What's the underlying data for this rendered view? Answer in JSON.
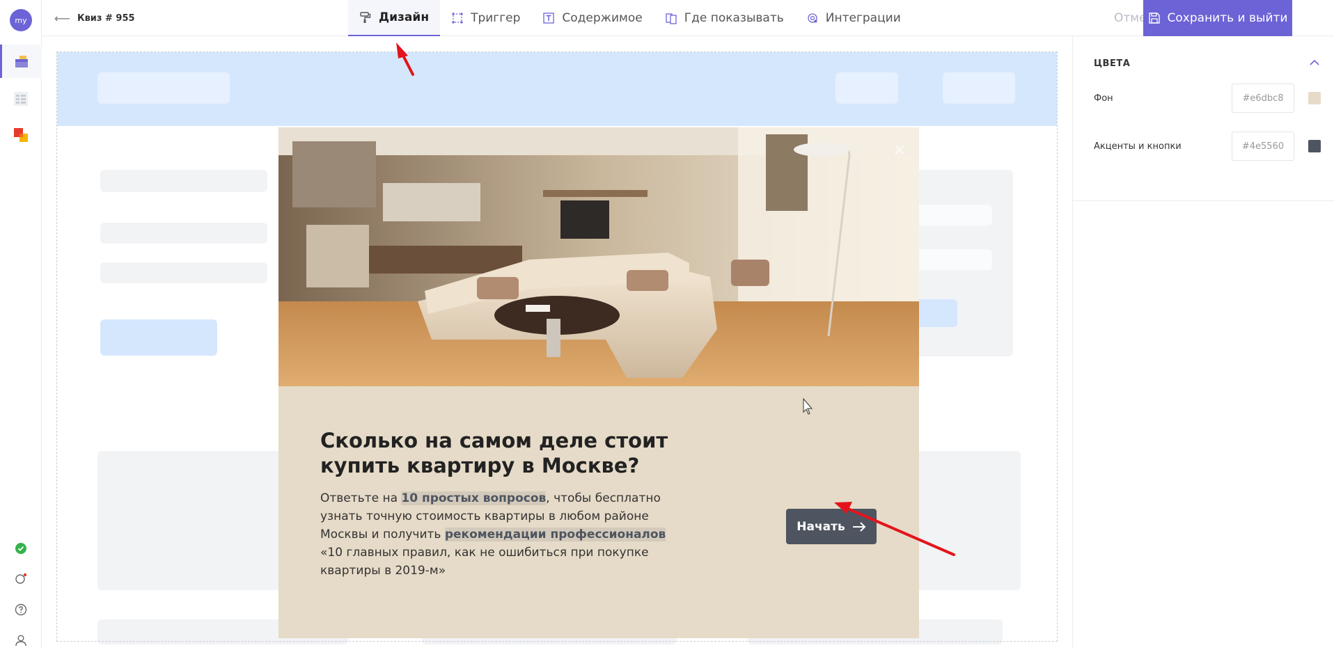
{
  "sidebar": {
    "avatar_text": "my"
  },
  "header": {
    "back_label": "Квиз # 955",
    "tabs": [
      {
        "label": "Дизайн",
        "icon": "paint-roller-icon"
      },
      {
        "label": "Триггер",
        "icon": "trigger-icon"
      },
      {
        "label": "Содержимое",
        "icon": "text-icon"
      },
      {
        "label": "Где показывать",
        "icon": "pages-icon"
      },
      {
        "label": "Интеграции",
        "icon": "integrations-icon"
      }
    ],
    "cancel_label": "Отменить",
    "save_label": "Сохранить и выйти"
  },
  "modal": {
    "close": "×",
    "title": "Сколько на самом деле стоит купить квартиру в Москве?",
    "text_1": "Ответьте на ",
    "highlight_1": "10 простых вопросов",
    "text_2": ", чтобы бесплатно узнать точную стоимость квартиры в любом районе Москвы и получить ",
    "highlight_2": "рекомендации профессионалов",
    "text_3": " «10 главных правил, как не ошибиться при покупке квартиры в 2019-м»",
    "start_label": "Начать"
  },
  "panel": {
    "section_title": "ЦВЕТА",
    "colors": [
      {
        "label": "Фон",
        "value": "#e6dbc8",
        "color": "#e6dbc8"
      },
      {
        "label": "Акценты и кнопки",
        "value": "#4e5560",
        "color": "#4e5560"
      }
    ]
  },
  "theme": {
    "accent": "#6c63d6",
    "annotation_arrow": "#e3141b"
  }
}
